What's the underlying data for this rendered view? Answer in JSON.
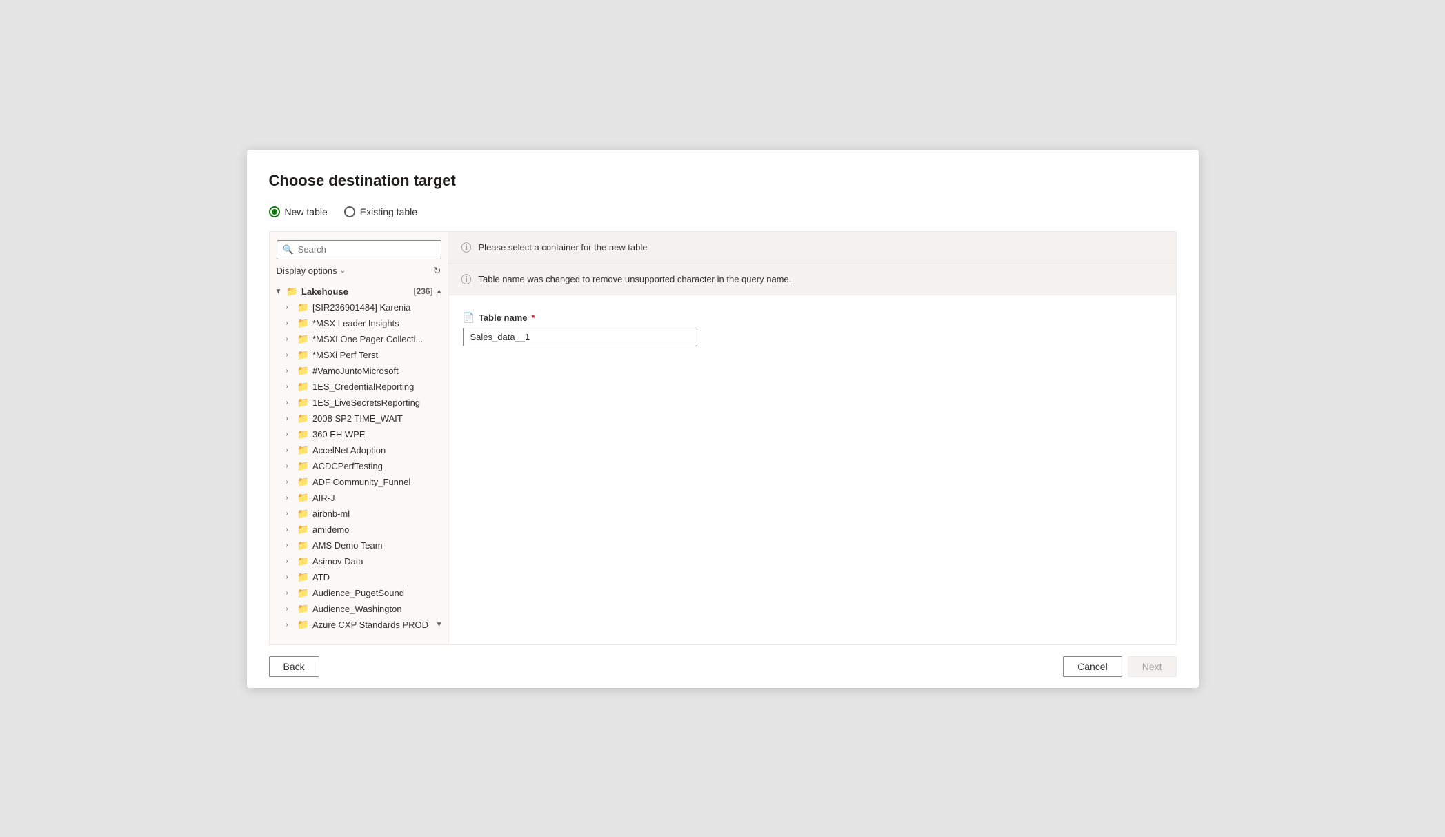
{
  "dialog": {
    "title": "Choose destination target"
  },
  "tabs": {
    "new_table": {
      "label": "New table",
      "selected": true
    },
    "existing_table": {
      "label": "Existing table",
      "selected": false
    }
  },
  "left_panel": {
    "search": {
      "placeholder": "Search",
      "value": ""
    },
    "display_options": {
      "label": "Display options"
    },
    "tree": {
      "root": {
        "label": "Lakehouse",
        "count": "[236]",
        "expanded": true
      },
      "items": [
        {
          "label": "[SIR236901484] Karenia",
          "indent": 1
        },
        {
          "label": "*MSX Leader Insights",
          "indent": 1
        },
        {
          "label": "*MSXI One Pager Collecti...",
          "indent": 1
        },
        {
          "label": "*MSXi Perf Terst",
          "indent": 1
        },
        {
          "label": "#VamoJuntoMicrosoft",
          "indent": 1
        },
        {
          "label": "1ES_CredentialReporting",
          "indent": 1
        },
        {
          "label": "1ES_LiveSecretsReporting",
          "indent": 1
        },
        {
          "label": "2008 SP2 TIME_WAIT",
          "indent": 1
        },
        {
          "label": "360 EH WPE",
          "indent": 1
        },
        {
          "label": "AccelNet Adoption",
          "indent": 1
        },
        {
          "label": "ACDCPerfTesting",
          "indent": 1
        },
        {
          "label": "ADF Community_Funnel",
          "indent": 1
        },
        {
          "label": "AIR-J",
          "indent": 1
        },
        {
          "label": "airbnb-ml",
          "indent": 1
        },
        {
          "label": "amldemo",
          "indent": 1
        },
        {
          "label": "AMS Demo Team",
          "indent": 1
        },
        {
          "label": "Asimov Data",
          "indent": 1
        },
        {
          "label": "ATD",
          "indent": 1
        },
        {
          "label": "Audience_PugetSound",
          "indent": 1
        },
        {
          "label": "Audience_Washington",
          "indent": 1
        },
        {
          "label": "Azure CXP Standards PROD",
          "indent": 1
        }
      ]
    }
  },
  "right_panel": {
    "info_banner": {
      "text": "Please select a container for the new table"
    },
    "warning_banner": {
      "text": "Table name was changed to remove unsupported character in the query name."
    },
    "form": {
      "table_name_label": "Table name",
      "table_name_value": "Sales_data__1",
      "required": true
    }
  },
  "footer": {
    "back_label": "Back",
    "cancel_label": "Cancel",
    "next_label": "Next"
  },
  "icons": {
    "search": "🔍",
    "info": "ℹ",
    "folder": "📁",
    "chevron_down": "⌄",
    "chevron_right": "›",
    "chevron_up": "▲",
    "chevron_down_scroll": "▼",
    "refresh": "↻",
    "table_name": "𝐓"
  }
}
